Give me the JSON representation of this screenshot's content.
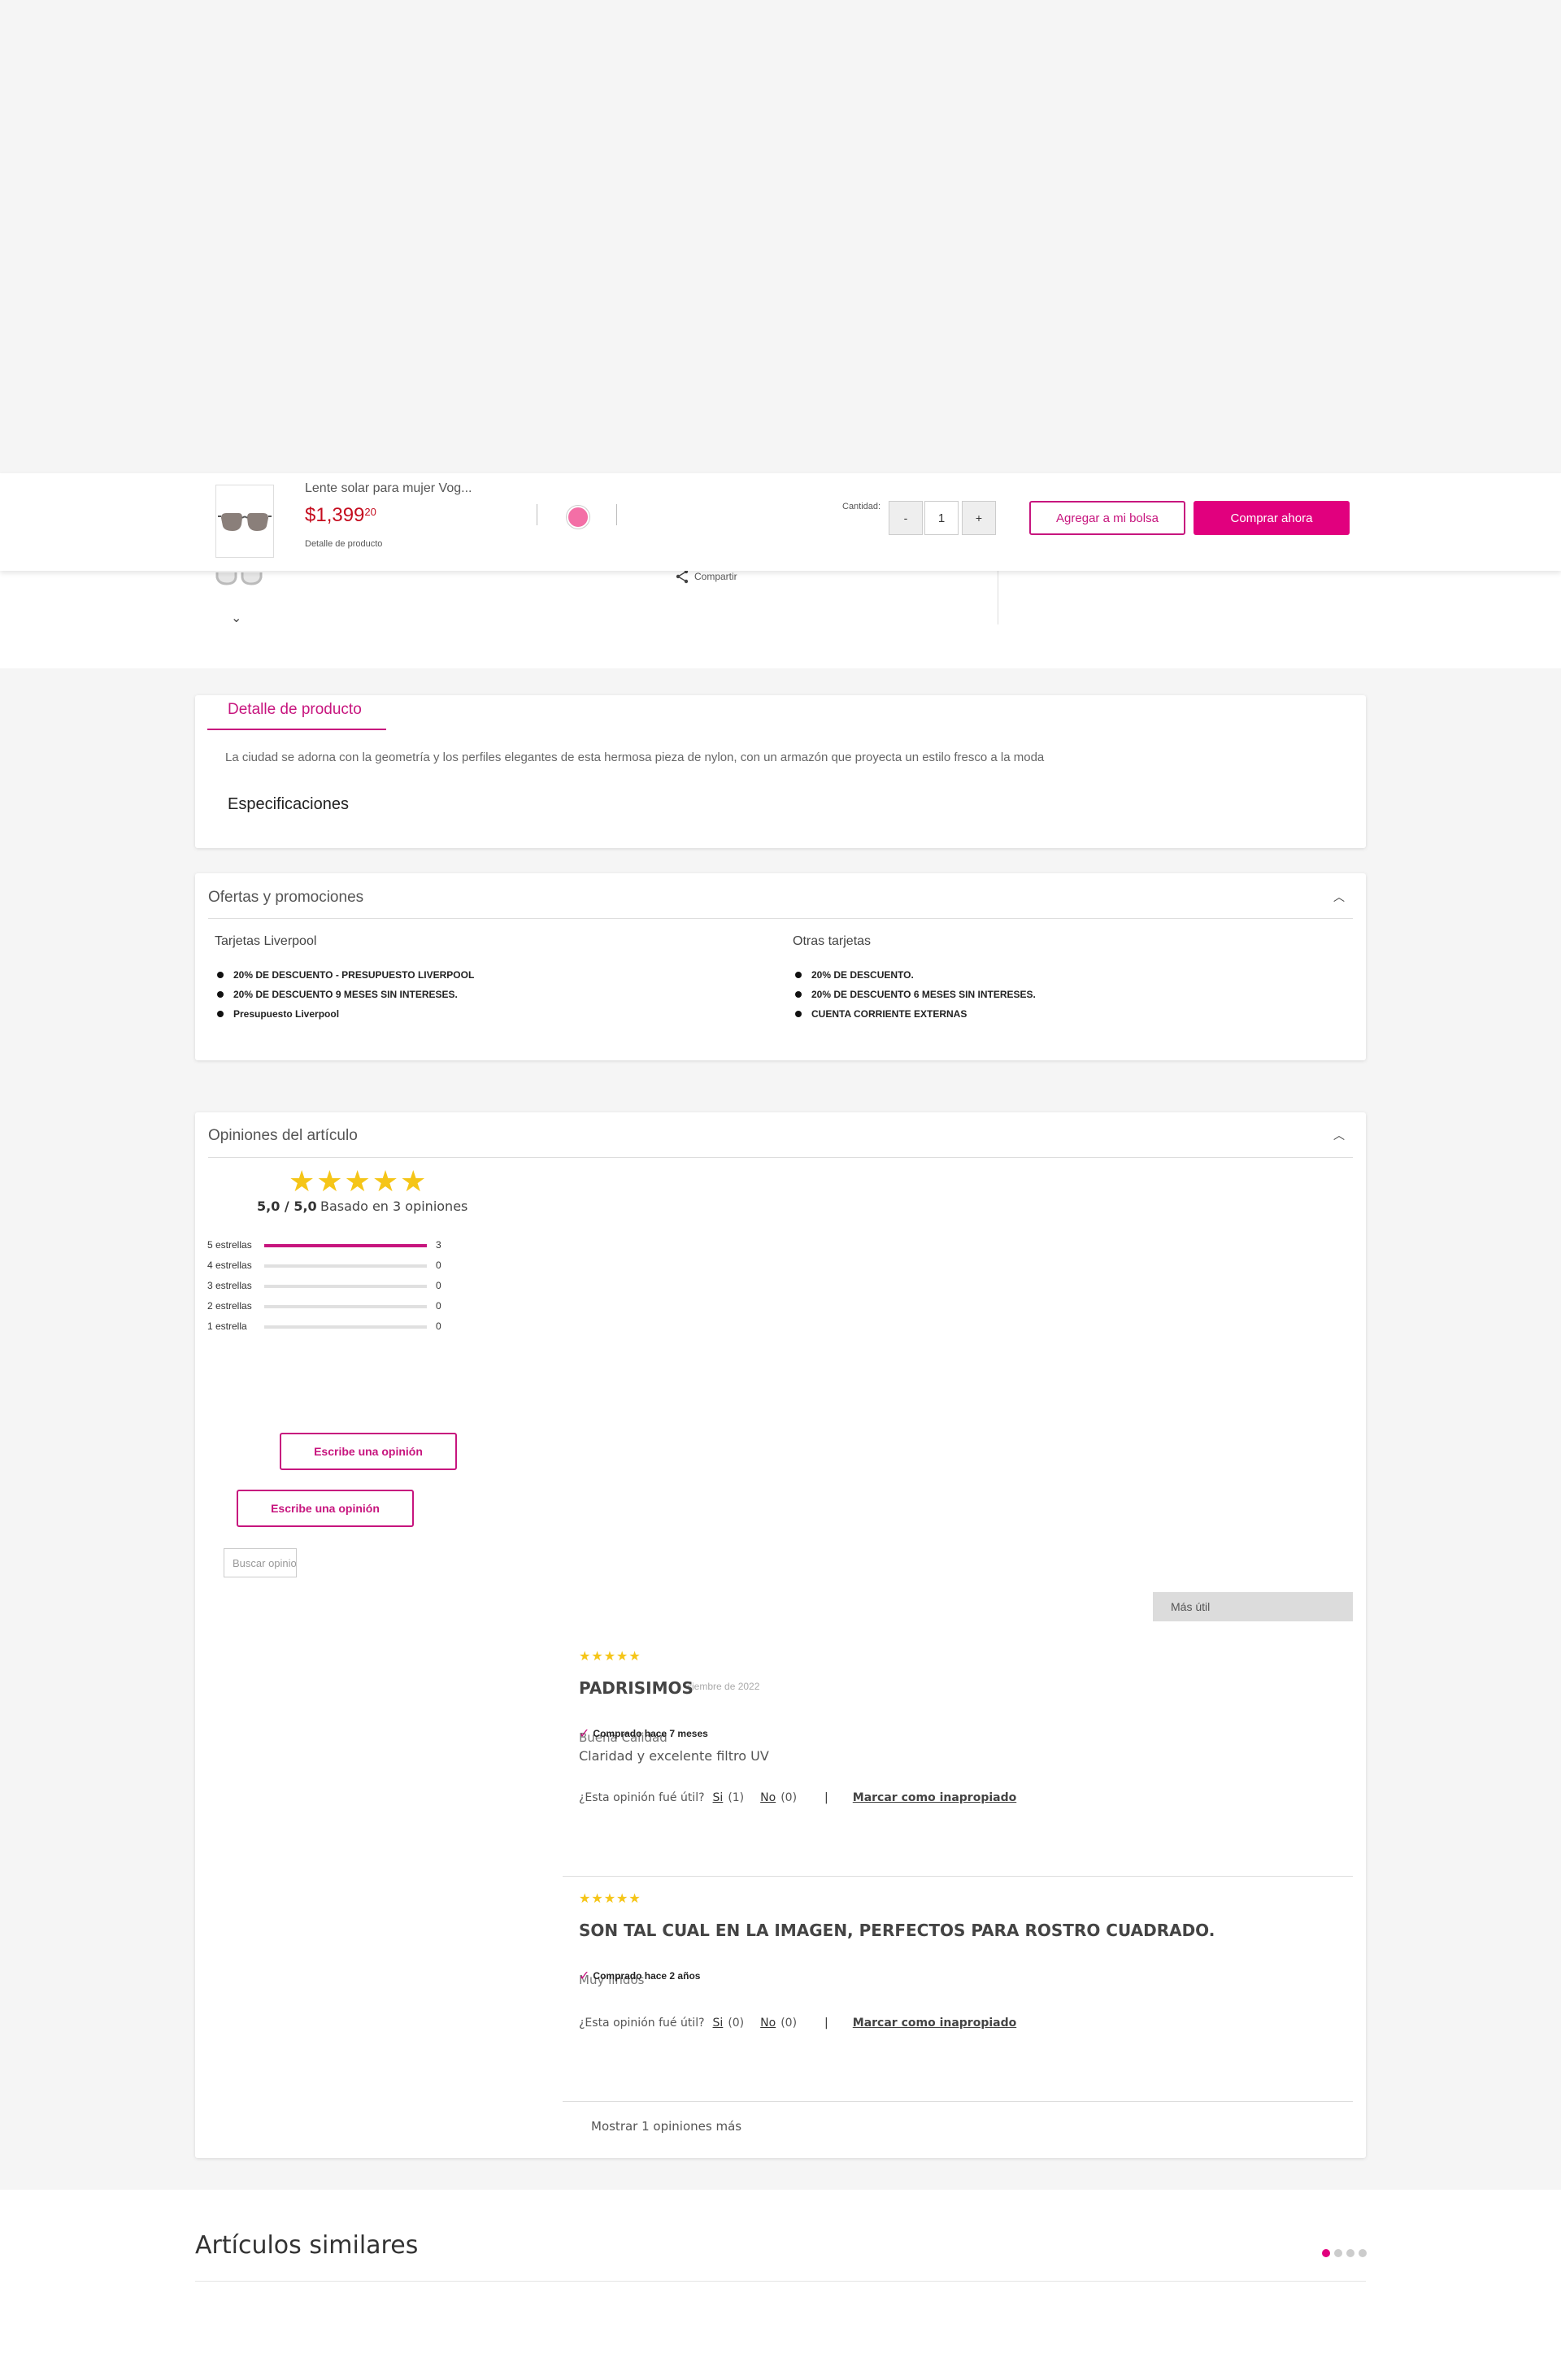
{
  "sticky": {
    "product_name": "Lente solar para mujer Vog...",
    "price_main": "$1,399",
    "price_cents": "20",
    "detail_link": "Detalle de producto",
    "qty_label": "Cantidad:",
    "qty_minus": "-",
    "qty_value": "1",
    "qty_plus": "+",
    "add_to_bag": "Agregar a mi bolsa",
    "buy_now": "Comprar ahora",
    "swatch_color": "#f36fa6"
  },
  "share_label": "Compartir",
  "detail": {
    "tab": "Detalle de producto",
    "description": "La ciudad se adorna con la geometría y los perfiles elegantes de esta hermosa pieza de nylon, con un armazón que proyecta un estilo fresco a la moda",
    "specs": "Especificaciones"
  },
  "promos": {
    "title": "Ofertas y promociones",
    "liverpool": {
      "heading": "Tarjetas Liverpool",
      "items": [
        "20% DE DESCUENTO - PRESUPUESTO LIVERPOOL",
        "20% DE DESCUENTO 9 MESES SIN INTERESES.",
        "Presupuesto Liverpool"
      ]
    },
    "other": {
      "heading": "Otras tarjetas",
      "items": [
        "20% DE DESCUENTO.",
        "20% DE DESCUENTO 6 MESES SIN INTERESES.",
        "CUENTA CORRIENTE EXTERNAS"
      ]
    }
  },
  "reviews": {
    "title": "Opiniones del artículo",
    "stars": "★★★★★",
    "average": "5,0 / 5,0",
    "based_on": "Basado en 3 opiniones",
    "histogram": [
      {
        "label": "5 estrellas",
        "count": "3",
        "fraction": 1.0
      },
      {
        "label": "4 estrellas",
        "count": "0",
        "fraction": 0
      },
      {
        "label": "3 estrellas",
        "count": "0",
        "fraction": 0
      },
      {
        "label": "2 estrellas",
        "count": "0",
        "fraction": 0
      },
      {
        "label": "1 estrella",
        "count": "0",
        "fraction": 0
      }
    ],
    "write_review": "Escribe una opinión",
    "search_placeholder": "Buscar opiniones",
    "sort_value": "Más útil",
    "helpful_question": "¿Esta opinión fué útil?",
    "flag_label": "Marcar como inapropiado",
    "more": "Mostrar 1 opiniones más",
    "items": [
      {
        "stars": "★★★★★",
        "title": "PADRISIMOS",
        "date": "ciembre de 2022",
        "bought": "Comprado hace 7 meses",
        "subtitle": "Buena Calidad",
        "body": "Claridad y excelente filtro UV",
        "yes": "Si",
        "yes_count": "(1)",
        "no": "No",
        "no_count": "(0)"
      },
      {
        "stars": "★★★★★",
        "title": "SON TAL CUAL EN LA IMAGEN, PERFECTOS PARA ROSTRO CUADRADO.",
        "date": "",
        "bought": "Comprado hace 2 años",
        "subtitle": "Muy lindos",
        "body": "",
        "yes": "Si",
        "yes_count": "(0)",
        "no": "No",
        "no_count": "(0)"
      }
    ]
  },
  "similar": {
    "title": "Artículos similares"
  },
  "colors": {
    "brand_pink": "#e1007e",
    "brand_pink_dark": "#c7157e",
    "price_red": "#c50d1f",
    "star_yellow": "#f5c518"
  }
}
